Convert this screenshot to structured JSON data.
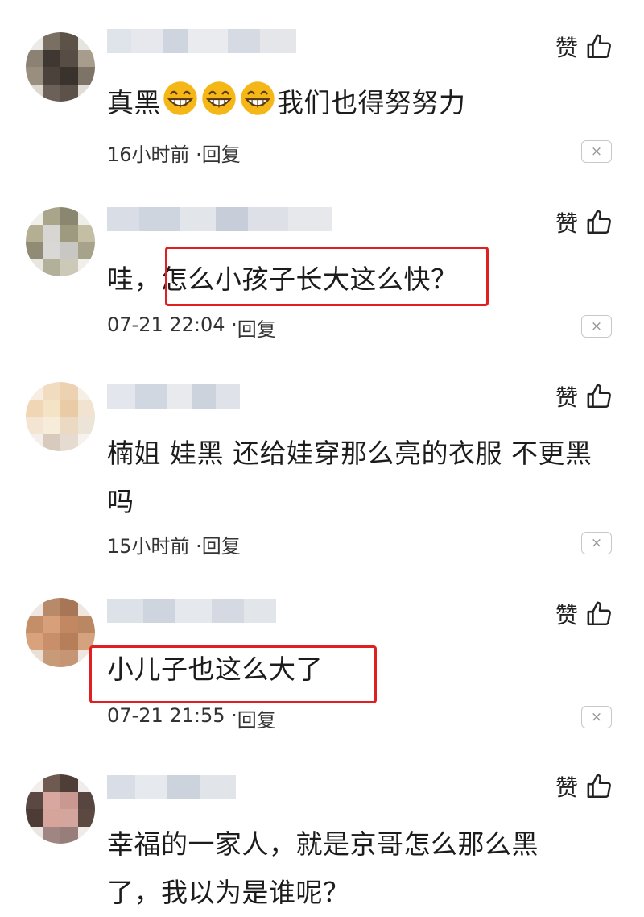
{
  "comments": [
    {
      "text_before": "真黑",
      "emoji_count": 3,
      "emoji_name": "grinning-face",
      "text_after": "我们也得努努力",
      "meta": "16小时前 · ",
      "reply": "回复",
      "like": "赞",
      "dismiss": "×"
    },
    {
      "text_prefix": "哇，",
      "text_highlight": "怎么小孩子长大这么快？",
      "meta": "07-21 22:04 · ",
      "reply": "回复",
      "like": "赞",
      "dismiss": "×"
    },
    {
      "text": "楠姐 娃黑 还给娃穿那么亮的衣服 不更黑吗",
      "meta": "15小时前 · ",
      "reply": "回复",
      "like": "赞",
      "dismiss": "×"
    },
    {
      "text_highlight": "小儿子也这么大了",
      "meta": "07-21 21:55 · ",
      "reply": "回复",
      "like": "赞",
      "dismiss": "×"
    },
    {
      "text": "幸福的一家人，就是京哥怎么那么黑了，我以为是谁呢？",
      "like": "赞"
    }
  ],
  "colors": {
    "highlight": "#e02020",
    "emoji": "#f5b617"
  }
}
